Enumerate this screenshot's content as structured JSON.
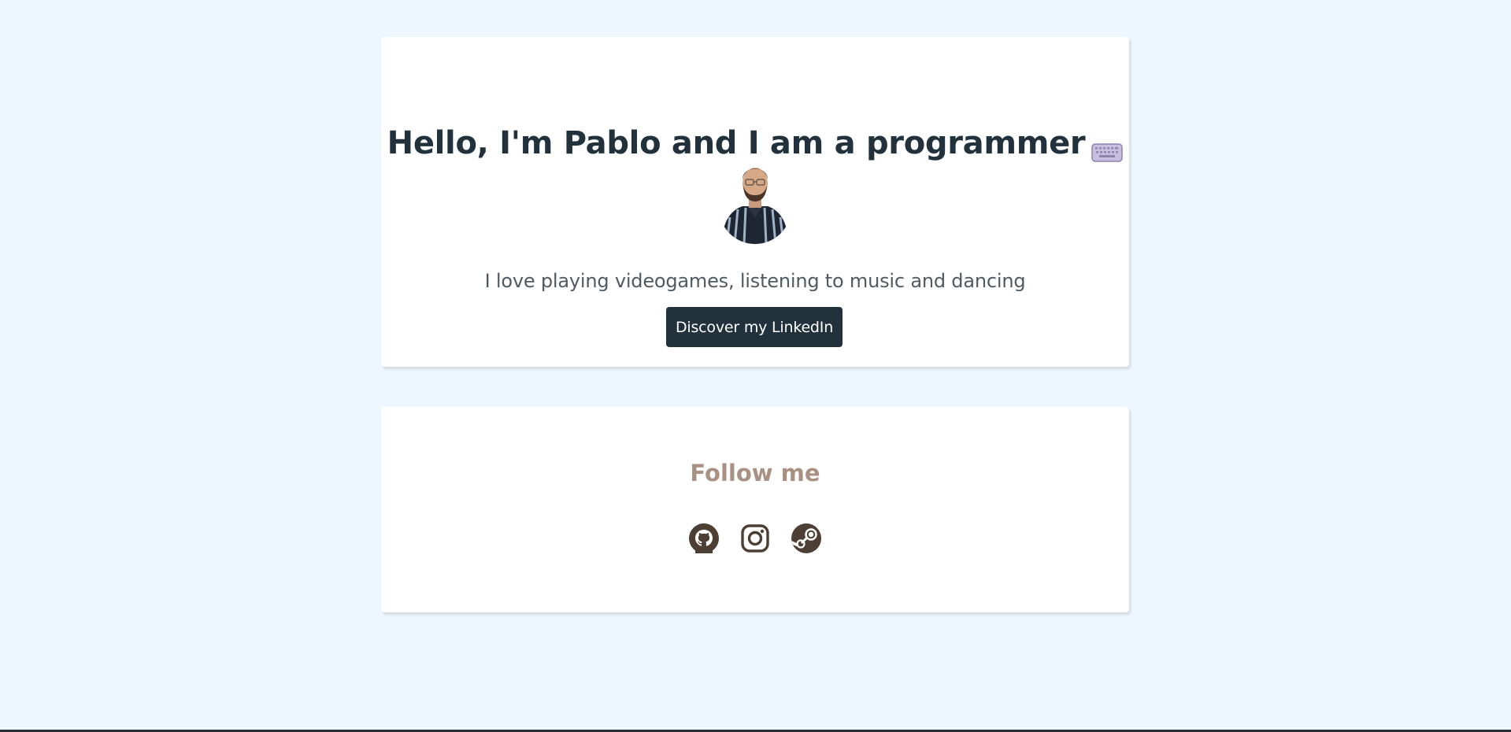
{
  "hero": {
    "title": "Hello, I'm Pablo and I am a programmer",
    "title_icon": "keyboard-icon",
    "avatar_alt": "photo-of-pablo",
    "tagline": "I love playing videogames, listening to music and dancing",
    "linkedin_label": "Discover my LinkedIn"
  },
  "follow": {
    "title": "Follow me",
    "links": [
      {
        "icon": "github-icon"
      },
      {
        "icon": "instagram-icon"
      },
      {
        "icon": "steam-icon"
      }
    ]
  },
  "colors": {
    "background": "#eef6ff",
    "card": "#ffffff",
    "title_text": "#22323d",
    "button_bg": "#22323d",
    "follow_title": "#a89182",
    "social_icon": "#4d3f34"
  }
}
